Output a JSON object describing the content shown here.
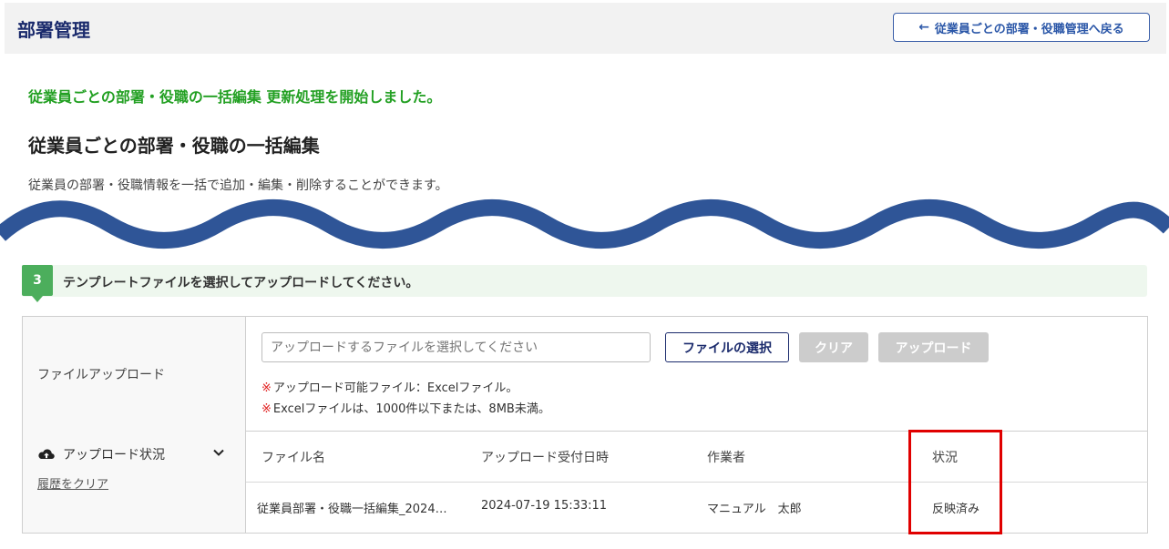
{
  "header": {
    "title": "部署管理",
    "back_button": "従業員ごとの部署・役職管理へ戻る"
  },
  "message": {
    "success": "従業員ごとの部署・役職の一括編集 更新処理を開始しました。"
  },
  "page": {
    "heading": "従業員ごとの部署・役職の一括編集",
    "description": "従業員の部署・役職情報を一括で追加・編集・削除することができます。"
  },
  "step": {
    "number": "3",
    "text": "テンプレートファイルを選択してアップロードしてください。"
  },
  "upload": {
    "label": "ファイルアップロード",
    "placeholder": "アップロードするファイルを選択してください",
    "select_button": "ファイルの選択",
    "clear_button": "クリア",
    "upload_button": "アップロード",
    "note_mark": "※",
    "note1": "アップロード可能ファイル：Excelファイル。",
    "note2": "Excelファイルは、1000件以下または、8MB未満。"
  },
  "status": {
    "label": "アップロード状況",
    "clear_history": "履歴をクリア",
    "columns": [
      "ファイル名",
      "アップロード受付日時",
      "作業者",
      "状況"
    ],
    "rows": [
      [
        "従業員部署・役職一括編集_2024…",
        "2024-07-19 15:33:11",
        "マニュアル　太郎",
        "反映済み"
      ]
    ]
  },
  "colors": {
    "brand": "#1a2a6c",
    "success": "#23a023",
    "step_green": "#4cae5c",
    "highlight_red": "#e00000",
    "wave_blue": "#2f5597"
  }
}
